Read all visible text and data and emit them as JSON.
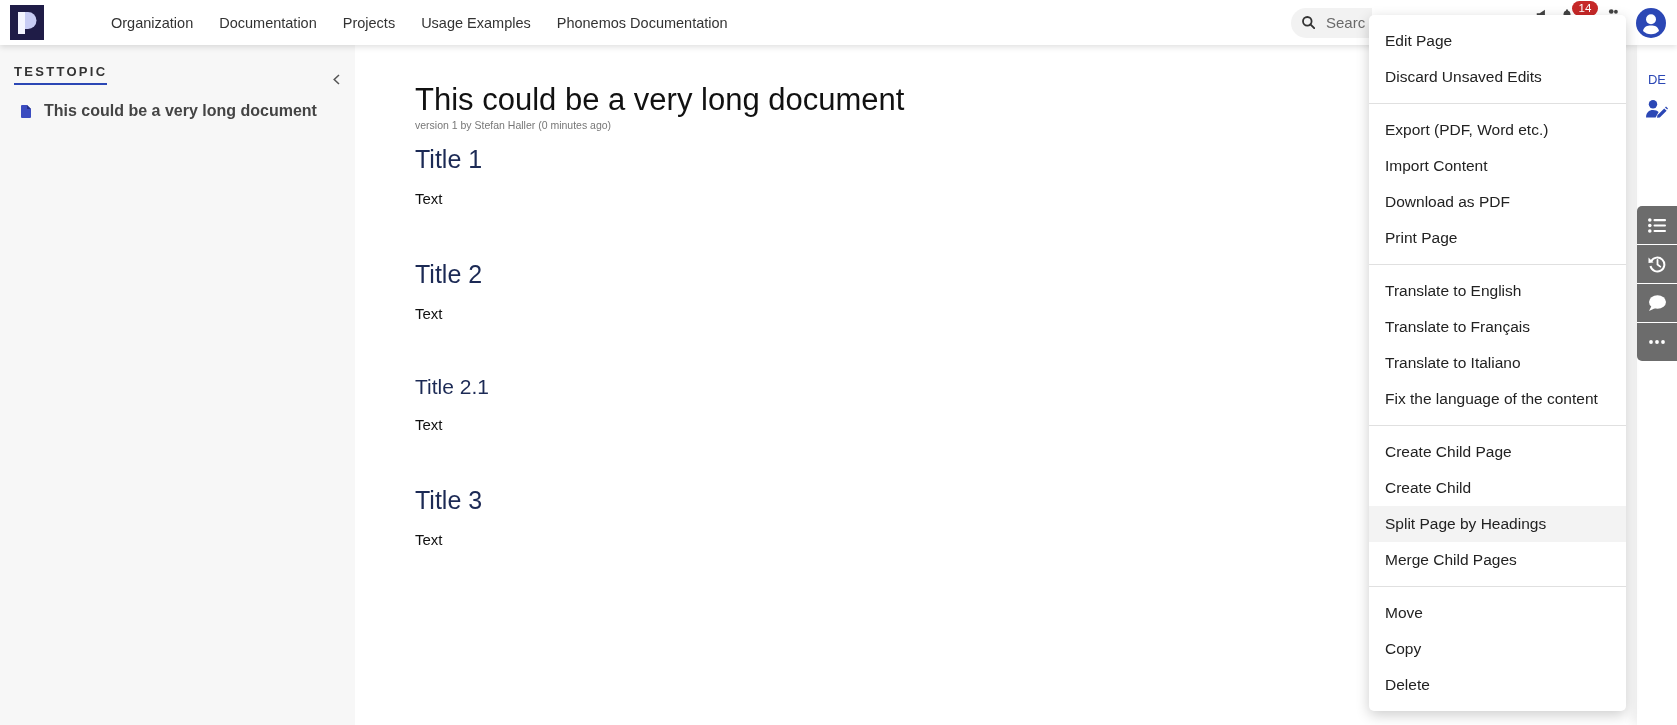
{
  "header": {
    "nav": [
      "Organization",
      "Documentation",
      "Projects",
      "Usage Examples",
      "Phonemos Documentation"
    ],
    "search": {
      "placeholder": "Searc"
    },
    "notification_count": "14"
  },
  "sidebar": {
    "title": "TESTTOPIC",
    "pages": [
      {
        "title": "This could be a very long document"
      }
    ]
  },
  "document": {
    "title": "This could be a very long document",
    "meta": "version 1 by Stefan Haller (0 minutes ago)",
    "sections": [
      {
        "kind": "h1",
        "heading": "Title 1",
        "text": "Text"
      },
      {
        "kind": "h1",
        "heading": "Title 2",
        "text": "Text"
      },
      {
        "kind": "h2",
        "heading": "Title 2.1",
        "text": "Text"
      },
      {
        "kind": "h1",
        "heading": "Title 3",
        "text": "Text"
      }
    ]
  },
  "right_rail": {
    "language": "DE"
  },
  "menu": {
    "groups": [
      {
        "items": [
          {
            "label": "Edit Page",
            "highlighted": false
          },
          {
            "label": "Discard Unsaved Edits",
            "highlighted": false
          }
        ]
      },
      {
        "items": [
          {
            "label": "Export (PDF, Word etc.)",
            "highlighted": false
          },
          {
            "label": "Import Content",
            "highlighted": false
          },
          {
            "label": "Download as PDF",
            "highlighted": false
          },
          {
            "label": "Print Page",
            "highlighted": false
          }
        ]
      },
      {
        "items": [
          {
            "label": "Translate to English",
            "highlighted": false
          },
          {
            "label": "Translate to Français",
            "highlighted": false
          },
          {
            "label": "Translate to Italiano",
            "highlighted": false
          },
          {
            "label": "Fix the language of the content",
            "highlighted": false
          }
        ]
      },
      {
        "items": [
          {
            "label": "Create Child Page",
            "highlighted": false
          },
          {
            "label": "Create Child",
            "highlighted": false
          },
          {
            "label": "Split Page by Headings",
            "highlighted": true
          },
          {
            "label": "Merge Child Pages",
            "highlighted": false
          }
        ]
      },
      {
        "items": [
          {
            "label": "Move",
            "highlighted": false
          },
          {
            "label": "Copy",
            "highlighted": false
          },
          {
            "label": "Delete",
            "highlighted": false
          }
        ]
      }
    ]
  }
}
